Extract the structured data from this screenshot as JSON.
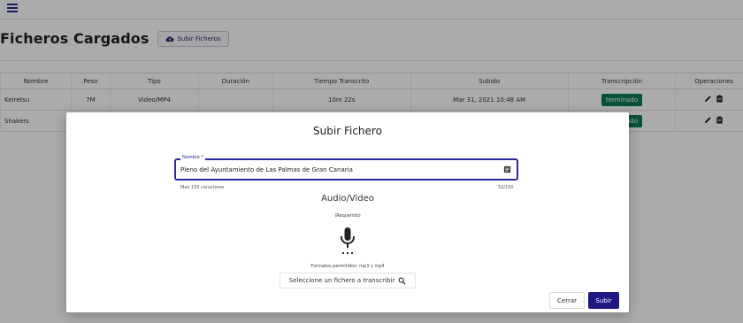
{
  "header": {
    "menu_icon": "hamburger-icon"
  },
  "page": {
    "title": "Ficheros Cargados",
    "upload_button_label": "Subir Ficheros",
    "upload_icon": "cloud-upload-icon"
  },
  "table": {
    "headers": [
      "Nombre",
      "Peso",
      "Tipo",
      "Duración",
      "Tiempo Transcrito",
      "Subido",
      "Transcripción",
      "Operaciones"
    ],
    "rows": [
      {
        "name": "Keiretsu",
        "size": "7M",
        "type": "Video/MP4",
        "duration": "",
        "transcribed": "10m 22s",
        "uploaded": "Mar 31, 2021 10:48 AM",
        "status": "terminado"
      },
      {
        "name": "Shakers",
        "size": "",
        "type": "",
        "duration": "",
        "transcribed": "",
        "uploaded": "",
        "status": "terminado"
      }
    ],
    "status_color": "#0e7a52"
  },
  "dialog": {
    "title": "Subir Fichero",
    "name_field": {
      "label": "Nombre *",
      "value": "Pleno del Ayuntamiento de Las Palmas de Gran Canaria",
      "hint": "Max 150 caracteres",
      "counter": "52/150"
    },
    "section_title": "Audio/Video",
    "required_text": "(Requerido)",
    "mic_icon": "microphone-icon",
    "formats_text": "Formatos permitidos: mp3 y mp4",
    "select_file_label": "Seleccione un fichero a transcribir",
    "close_label": "Cerrar",
    "submit_label": "Subir",
    "accent_color": "#1f1883"
  }
}
